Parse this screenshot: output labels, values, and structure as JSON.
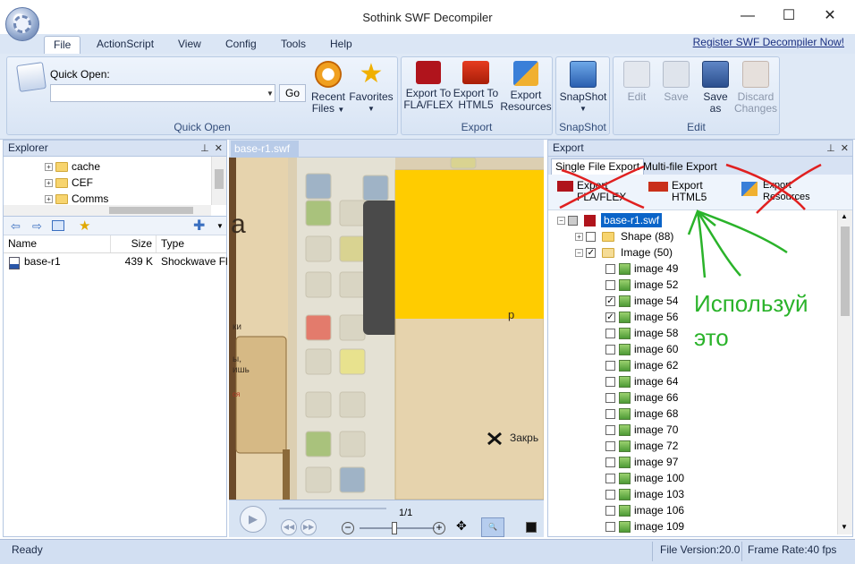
{
  "window": {
    "title": "Sothink SWF Decompiler",
    "minimize": "—",
    "maximize": "☐",
    "close": "✕"
  },
  "menu": {
    "items": [
      "File",
      "ActionScript",
      "View",
      "Config",
      "Tools",
      "Help"
    ],
    "active": "File",
    "register": "Register SWF Decompiler Now!"
  },
  "ribbon": {
    "quick_open": {
      "label": "Quick Open:",
      "value": "",
      "go": "Go",
      "group": "Quick Open",
      "recent": "Recent",
      "recent2": "Files",
      "favorites": "Favorites"
    },
    "export": {
      "group": "Export",
      "fla": [
        "Export To",
        "FLA/FLEX"
      ],
      "html5": [
        "Export To",
        "HTML5"
      ],
      "res": [
        "Export",
        "Resources"
      ]
    },
    "snapshot": {
      "group": "SnapShot",
      "label": "SnapShot"
    },
    "edit": {
      "group": "Edit",
      "edit": "Edit",
      "save": "Save",
      "save_as": [
        "Save",
        "as"
      ],
      "discard": [
        "Discard",
        "Changes"
      ]
    }
  },
  "explorer": {
    "title": "Explorer",
    "tree": [
      "cache",
      "CEF",
      "Comms"
    ],
    "columns": {
      "name": "Name",
      "size": "Size",
      "type": "Type"
    },
    "files": [
      {
        "name": "base-r1",
        "size": "439 K",
        "type": "Shockwave Fl"
      }
    ]
  },
  "document": {
    "tab": "base-r1.swf",
    "frame": "1/1",
    "stage_texts": [
      "а",
      "ки",
      "ы,",
      "ишь",
      "ся",
      "р",
      "Закрь"
    ]
  },
  "export_panel": {
    "title": "Export",
    "tabs": [
      "Single File Export",
      "Multi-file Export"
    ],
    "buttons": {
      "fla": [
        "Export",
        "FLA/FLEX"
      ],
      "html5": [
        "Export",
        "HTML5"
      ],
      "res": [
        "Export",
        "Resources"
      ]
    },
    "root": "base-r1.swf",
    "shape": "Shape (88)",
    "image": "Image (50)",
    "images": [
      {
        "name": "image 49",
        "checked": false
      },
      {
        "name": "image 52",
        "checked": false
      },
      {
        "name": "image 54",
        "checked": true
      },
      {
        "name": "image 56",
        "checked": true
      },
      {
        "name": "image 58",
        "checked": false
      },
      {
        "name": "image 60",
        "checked": false
      },
      {
        "name": "image 62",
        "checked": false
      },
      {
        "name": "image 64",
        "checked": false
      },
      {
        "name": "image 66",
        "checked": false
      },
      {
        "name": "image 68",
        "checked": false
      },
      {
        "name": "image 70",
        "checked": false
      },
      {
        "name": "image 72",
        "checked": false
      },
      {
        "name": "image 97",
        "checked": false
      },
      {
        "name": "image 100",
        "checked": false
      },
      {
        "name": "image 103",
        "checked": false
      },
      {
        "name": "image 106",
        "checked": false
      },
      {
        "name": "image 109",
        "checked": false
      }
    ]
  },
  "annotation": {
    "line1": "Используй",
    "line2": "это"
  },
  "status": {
    "ready": "Ready",
    "file_version": "File Version:20.0",
    "frame_rate": "Frame Rate:40 fps"
  },
  "colors": {
    "annotation_red": "#e02020",
    "annotation_green": "#2ab32a",
    "stage_yellow": "#ffcc00",
    "selection": "#0a64c8"
  }
}
